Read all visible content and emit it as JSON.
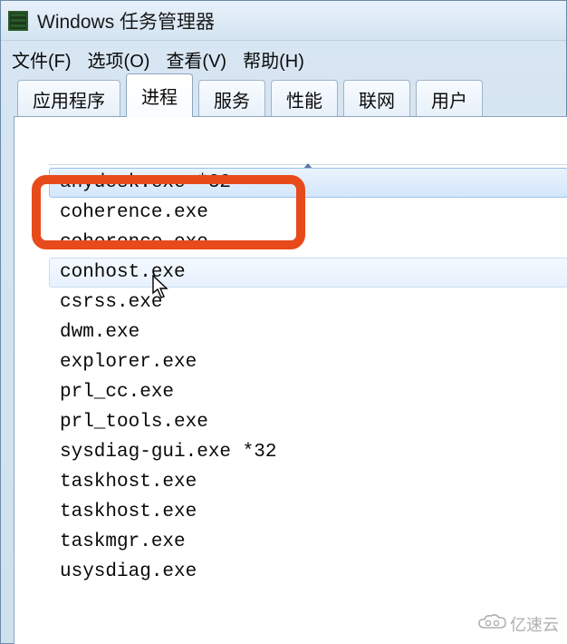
{
  "window": {
    "title": "Windows 任务管理器"
  },
  "menu": {
    "file": "文件(F)",
    "options": "选项(O)",
    "view": "查看(V)",
    "help": "帮助(H)"
  },
  "tabs": {
    "apps": "应用程序",
    "processes": "进程",
    "services": "服务",
    "performance": "性能",
    "networking": "联网",
    "users": "用户"
  },
  "processes": [
    "anydesk.exe *32",
    "coherence.exe",
    "coherence.exe",
    "conhost.exe",
    "csrss.exe",
    "dwm.exe",
    "explorer.exe",
    "prl_cc.exe",
    "prl_tools.exe",
    "sysdiag-gui.exe *32",
    "taskhost.exe",
    "taskhost.exe",
    "taskmgr.exe",
    "usysdiag.exe"
  ],
  "selected_index": 0,
  "hover_index": 3,
  "watermark": "亿速云"
}
